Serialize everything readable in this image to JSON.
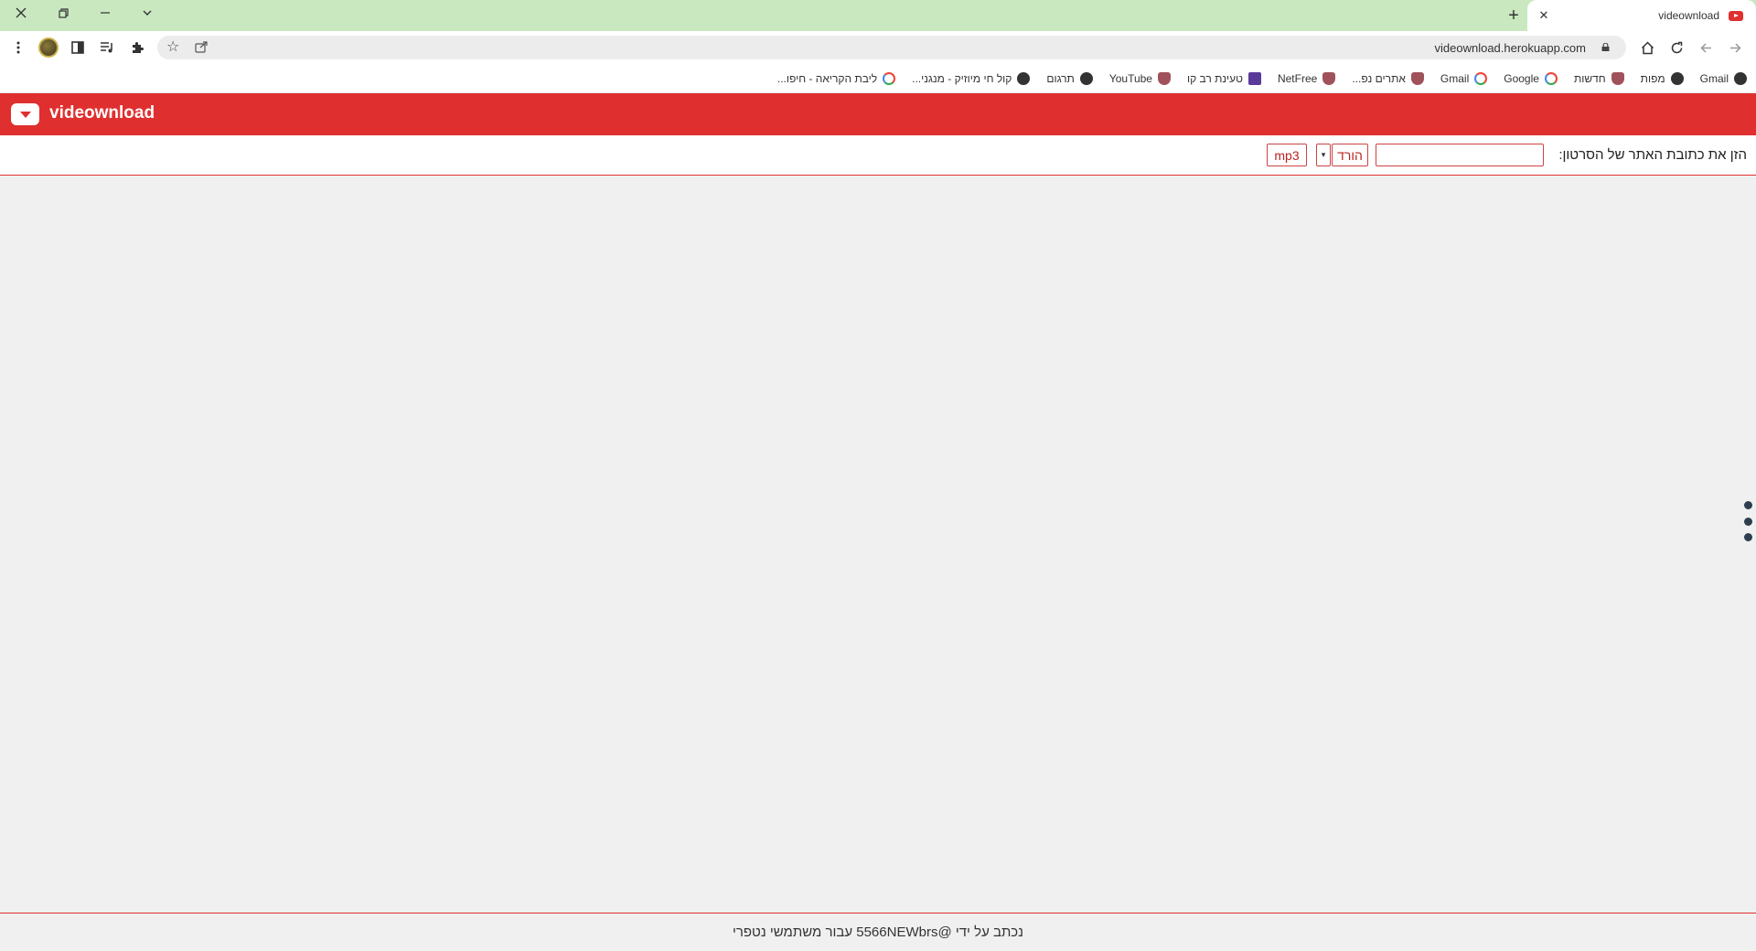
{
  "browser": {
    "tab_title": "videownload",
    "url": "videownload.herokuapp.com",
    "bookmarks": [
      {
        "label": "Gmail",
        "icon": "globe-icon"
      },
      {
        "label": "מפות",
        "icon": "globe-icon"
      },
      {
        "label": "חדשות",
        "icon": "shield-icon"
      },
      {
        "label": "Google",
        "icon": "google-icon"
      },
      {
        "label": "Gmail",
        "icon": "google-icon"
      },
      {
        "label": "אתרים נפ...",
        "icon": "shield-icon"
      },
      {
        "label": "NetFree",
        "icon": "shield-icon"
      },
      {
        "label": "טעינת רב קו",
        "icon": "app-icon"
      },
      {
        "label": "YouTube",
        "icon": "shield-icon"
      },
      {
        "label": "תרגום",
        "icon": "globe-icon"
      },
      {
        "label": "קול חי מיוזיק - מנגני...",
        "icon": "globe-icon"
      },
      {
        "label": "ליבת הקריאה - חיפו...",
        "icon": "google-icon"
      }
    ]
  },
  "app": {
    "title": "videownload",
    "brand_color": "#e02f2f"
  },
  "form": {
    "label": "הזן את כתובת האתר של הסרטון:",
    "url_value": "",
    "download_label": "הורד",
    "dropdown_arrow": "▾",
    "mp3_label": "mp3"
  },
  "footer": {
    "text": "נכתב על ידי @5566NEWbrs עבור משתמשי נטפרי"
  }
}
